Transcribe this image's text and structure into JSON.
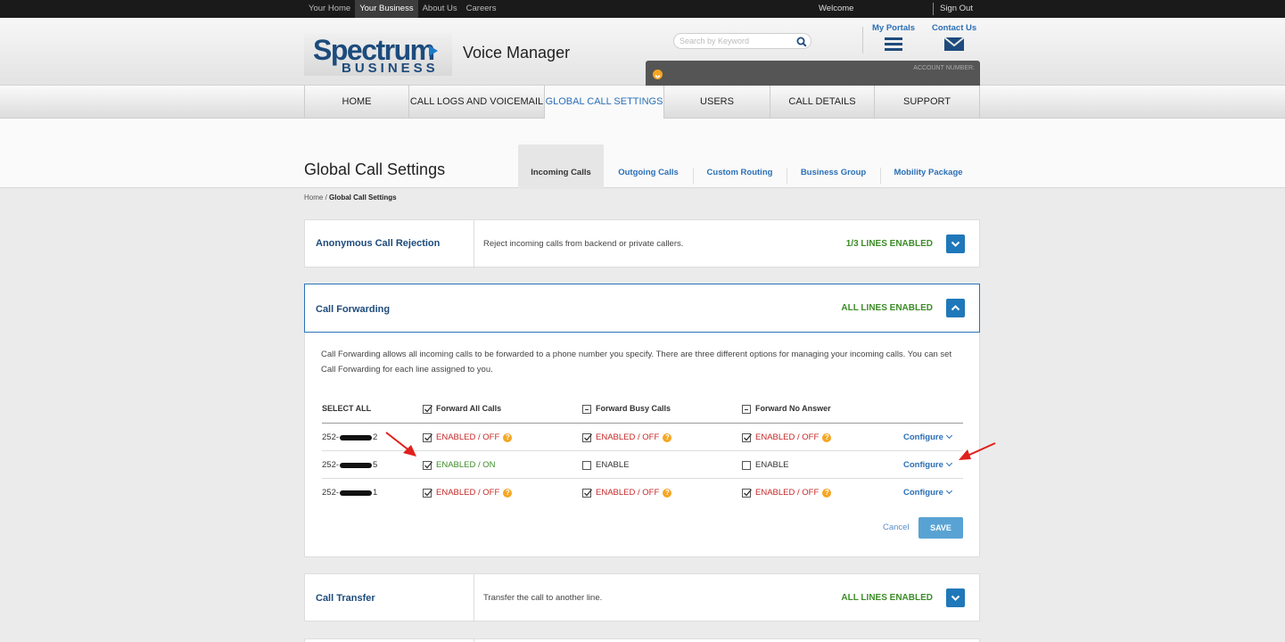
{
  "topbar": {
    "links": [
      "Your Home",
      "Your Business",
      "About Us",
      "Careers"
    ],
    "welcome": "Welcome",
    "signout": "Sign Out"
  },
  "header": {
    "logo_brand": "Spectrum",
    "logo_sub": "BUSINESS",
    "app_title": "Voice Manager",
    "search_placeholder": "Search by Keyword",
    "my_portals": "My Portals",
    "contact_us": "Contact Us",
    "account_number_label": "ACCOUNT NUMBER:"
  },
  "nav": {
    "items": [
      "HOME",
      "CALL LOGS AND VOICEMAIL",
      "GLOBAL CALL SETTINGS",
      "USERS",
      "CALL DETAILS",
      "SUPPORT"
    ],
    "active": "GLOBAL CALL SETTINGS"
  },
  "page": {
    "title": "Global Call Settings",
    "tabs": [
      "Incoming Calls",
      "Outgoing Calls",
      "Custom Routing",
      "Business Group",
      "Mobility Package"
    ],
    "active_tab": "Incoming Calls",
    "breadcrumb_home": "Home",
    "breadcrumb_sep": " / ",
    "breadcrumb_current": "Global Call Settings"
  },
  "panels": {
    "anonymous": {
      "name": "Anonymous Call Rejection",
      "desc": "Reject incoming calls from backend or private callers.",
      "status": "1/3 LINES ENABLED"
    },
    "forwarding": {
      "name": "Call Forwarding",
      "status": "ALL LINES ENABLED",
      "intro": "Call Forwarding allows all incoming calls to be forwarded to a phone number you specify. There are three different options for managing your incoming calls. You can set Call Forwarding for each line assigned to you.",
      "columns": [
        "SELECT ALL",
        "Forward All Calls",
        "Forward Busy Calls",
        "Forward No Answer"
      ],
      "rows": [
        {
          "prefix": "252-",
          "suffix": "2",
          "all": "ENABLED / OFF",
          "busy": "ENABLED / OFF",
          "noanswer": "ENABLED / OFF",
          "configure": "Configure"
        },
        {
          "prefix": "252-",
          "suffix": "5",
          "all": "ENABLED / ON",
          "busy": "ENABLE",
          "noanswer": "ENABLE",
          "configure": "Configure"
        },
        {
          "prefix": "252-",
          "suffix": "1",
          "all": "ENABLED / OFF",
          "busy": "ENABLED / OFF",
          "noanswer": "ENABLED / OFF",
          "configure": "Configure"
        }
      ],
      "cancel": "Cancel",
      "save": "SAVE"
    },
    "transfer": {
      "name": "Call Transfer",
      "desc": "Transfer the call to another line.",
      "status": "ALL LINES ENABLED"
    }
  },
  "colors": {
    "brand_blue": "#1d4b7c",
    "link_blue": "#2b6fb6",
    "status_green": "#3d8c28",
    "status_red": "#c62828",
    "help_orange": "#f5a623",
    "annotation_red": "#e0201b"
  }
}
